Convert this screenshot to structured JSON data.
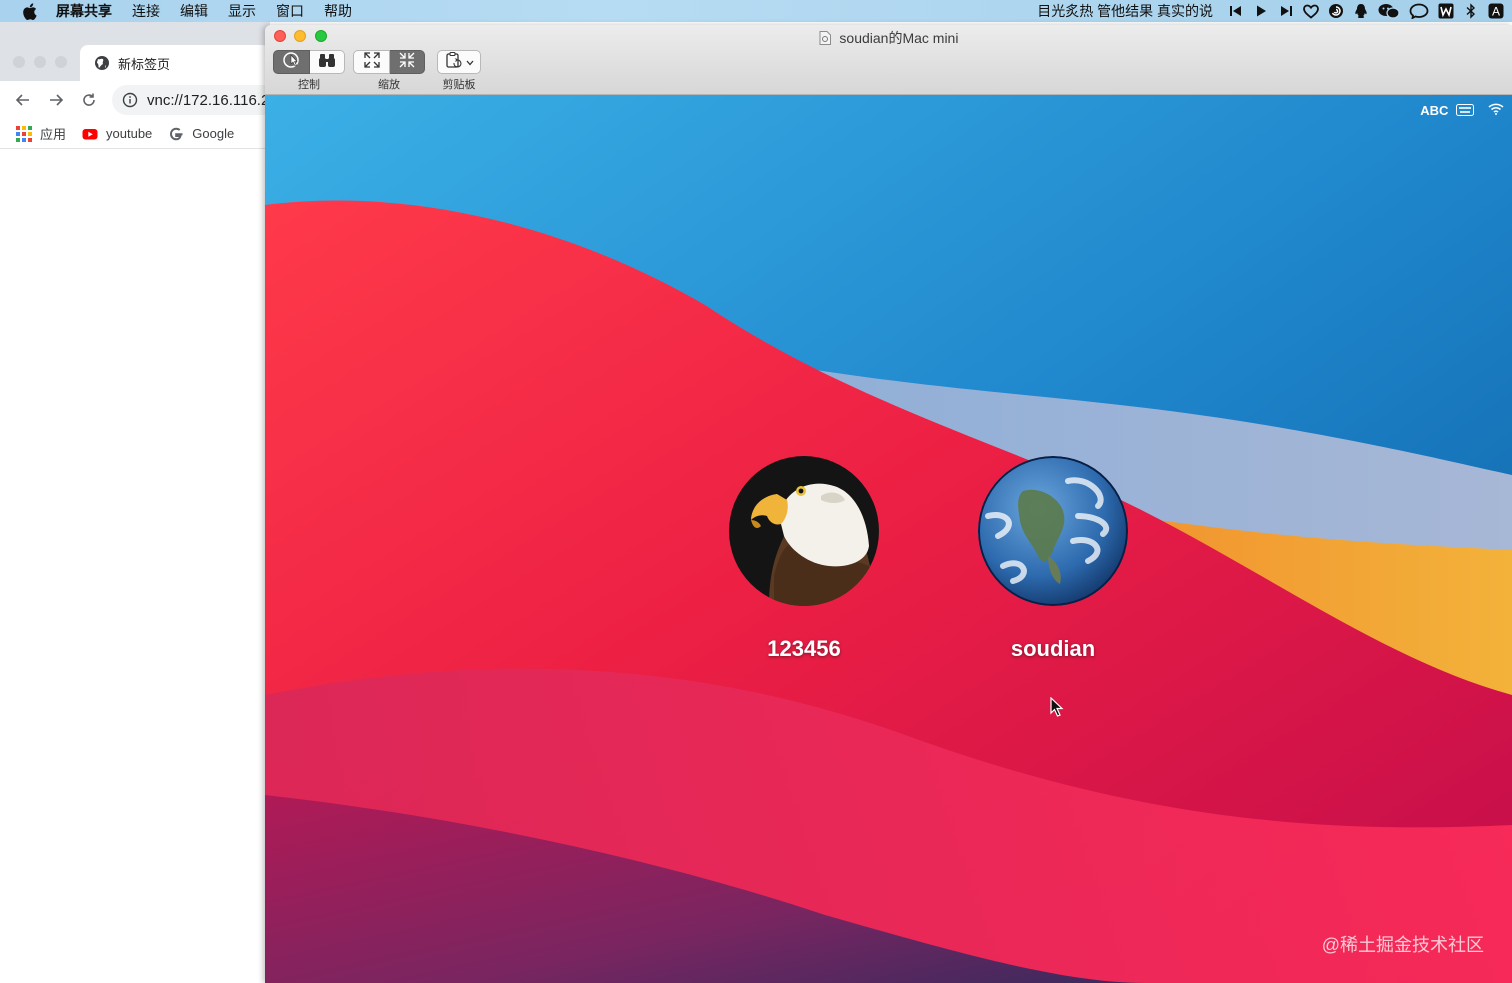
{
  "menubar": {
    "app_name": "屏幕共享",
    "menus": [
      "连接",
      "编辑",
      "显示",
      "窗口",
      "帮助"
    ],
    "now_playing": "目光炙热 管他结果 真实的说",
    "status_icons": [
      "previous-track-icon",
      "play-icon",
      "next-track-icon",
      "heart-icon",
      "swirl-icon",
      "qq-icon",
      "wechat-icon",
      "chat-bubble-icon",
      "w-app-icon",
      "bluetooth-icon",
      "input-method-icon"
    ],
    "input_method_label": "A"
  },
  "browser": {
    "tab_title": "新标签页",
    "address": "vnc://172.16.116.2",
    "bookmarks": [
      {
        "label": "应用",
        "icon": "apps-grid-icon"
      },
      {
        "label": "youtube",
        "icon": "youtube-icon"
      },
      {
        "label": "Google",
        "icon": "google-icon"
      }
    ]
  },
  "vnc_window": {
    "title": "soudian的Mac mini",
    "toolbar": {
      "control_label": "控制",
      "scale_label": "缩放",
      "clipboard_label": "剪贴板"
    }
  },
  "remote_desktop": {
    "keyboard_layout": "ABC",
    "users": [
      {
        "name": "123456",
        "avatar": "eagle"
      },
      {
        "name": "soudian",
        "avatar": "earth"
      }
    ],
    "watermark": "@稀土掘金技术社区"
  },
  "colors": {
    "menubar_bg": "#b0d8f1",
    "traffic_red": "#fe5f57",
    "traffic_yellow": "#febc2e",
    "traffic_green": "#28c840",
    "wallpaper_red": "#e8203f",
    "wallpaper_blue": "#1f7fc4",
    "wallpaper_orange": "#f29a2e"
  }
}
